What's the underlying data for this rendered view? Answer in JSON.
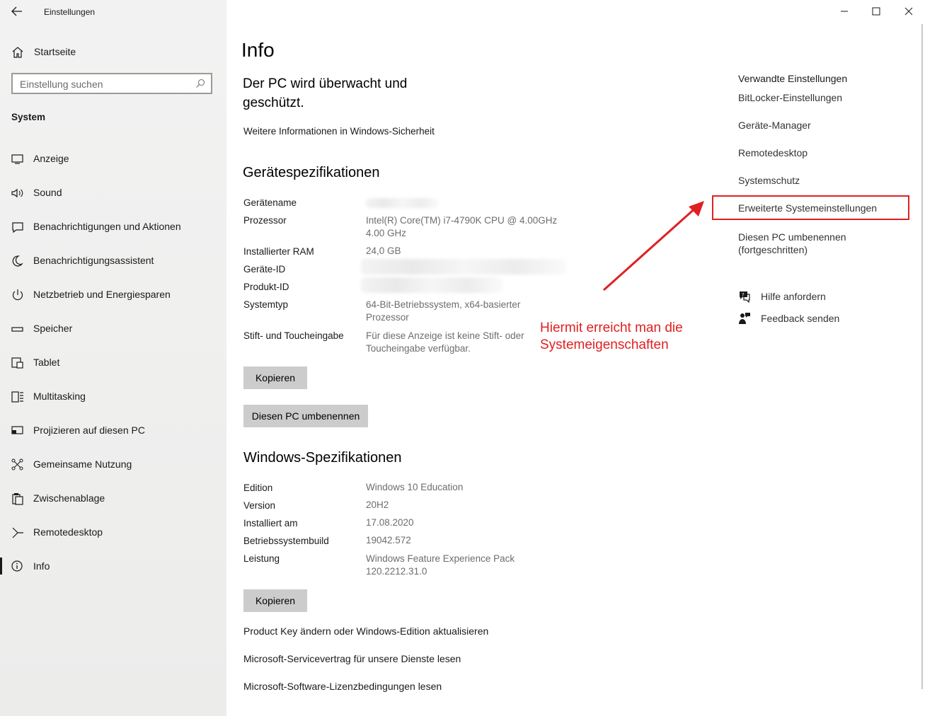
{
  "window": {
    "title": "Einstellungen"
  },
  "sidebar": {
    "home_label": "Startseite",
    "search_placeholder": "Einstellung suchen",
    "section_title": "System",
    "items": [
      {
        "label": "Anzeige",
        "icon": "monitor-icon"
      },
      {
        "label": "Sound",
        "icon": "speaker-icon"
      },
      {
        "label": "Benachrichtigungen und Aktionen",
        "icon": "notification-icon"
      },
      {
        "label": "Benachrichtigungsassistent",
        "icon": "moon-icon"
      },
      {
        "label": "Netzbetrieb und Energiesparen",
        "icon": "power-icon"
      },
      {
        "label": "Speicher",
        "icon": "storage-icon"
      },
      {
        "label": "Tablet",
        "icon": "tablet-icon"
      },
      {
        "label": "Multitasking",
        "icon": "multitasking-icon"
      },
      {
        "label": "Projizieren auf diesen PC",
        "icon": "project-icon"
      },
      {
        "label": "Gemeinsame Nutzung",
        "icon": "share-icon"
      },
      {
        "label": "Zwischenablage",
        "icon": "clipboard-icon"
      },
      {
        "label": "Remotedesktop",
        "icon": "remote-icon"
      },
      {
        "label": "Info",
        "icon": "info-icon",
        "selected": true
      }
    ]
  },
  "main": {
    "page_title": "Info",
    "security_heading_line1": "Der PC wird überwacht und",
    "security_heading_line2": "geschützt.",
    "security_link": "Weitere Informationen in Windows-Sicherheit",
    "device_specs": {
      "heading": "Gerätespezifikationen",
      "rows": [
        {
          "label": "Gerätename",
          "value": ""
        },
        {
          "label": "Prozessor",
          "value": "Intel(R) Core(TM) i7-4790K CPU @ 4.00GHz",
          "value2": "4.00 GHz"
        },
        {
          "label": "Installierter RAM",
          "value": "24,0 GB"
        },
        {
          "label": "Geräte-ID",
          "value": ""
        },
        {
          "label": "Produkt-ID",
          "value": ""
        },
        {
          "label": "Systemtyp",
          "value": "64-Bit-Betriebssystem, x64-basierter",
          "value2": "Prozessor"
        },
        {
          "label": "Stift- und Toucheingabe",
          "value": "Für diese Anzeige ist keine Stift- oder",
          "value2": "Toucheingabe verfügbar."
        }
      ],
      "copy_button": "Kopieren",
      "rename_button": "Diesen PC umbenennen"
    },
    "windows_specs": {
      "heading": "Windows-Spezifikationen",
      "rows": [
        {
          "label": "Edition",
          "value": "Windows 10 Education"
        },
        {
          "label": "Version",
          "value": "20H2"
        },
        {
          "label": "Installiert am",
          "value": "17.08.2020"
        },
        {
          "label": "Betriebssystembuild",
          "value": "19042.572"
        },
        {
          "label": "Leistung",
          "value": "Windows Feature Experience Pack",
          "value2": "120.2212.31.0"
        }
      ],
      "copy_button": "Kopieren"
    },
    "links": [
      "Product Key ändern oder Windows-Edition aktualisieren",
      "Microsoft-Servicevertrag für unsere Dienste lesen",
      "Microsoft-Software-Lizenzbedingungen lesen"
    ]
  },
  "related": {
    "heading": "Verwandte Einstellungen",
    "items": [
      "BitLocker-Einstellungen",
      "Geräte-Manager",
      "Remotedesktop",
      "Systemschutz",
      "Erweiterte Systemeinstellungen",
      "Diesen PC umbenennen",
      "(fortgeschritten)"
    ],
    "help": "Hilfe anfordern",
    "feedback": "Feedback senden"
  },
  "annotation": {
    "text_line1": "Hiermit erreicht man die",
    "text_line2": "Systemeigenschaften",
    "color": "#e02020"
  },
  "colors": {
    "sidebar_bg": "#f2f2f2",
    "button_bg": "#cccccc",
    "annotation": "#e02020"
  }
}
